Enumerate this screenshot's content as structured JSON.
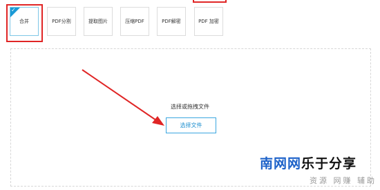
{
  "toolbar": {
    "tools": [
      {
        "label": "合并",
        "selected": true
      },
      {
        "label": "PDF分割"
      },
      {
        "label": "提取图片"
      },
      {
        "label": "压缩PDF"
      },
      {
        "label": "PDF解密"
      },
      {
        "label": "PDF 加密"
      }
    ]
  },
  "upload": {
    "hint": "选择或拖拽文件",
    "button_label": "选择文件"
  },
  "annotation": {
    "color": "#e02525"
  },
  "watermark": {
    "brand_part1": "南网网",
    "brand_part2": "乐于分享",
    "tagline": "资源 网赚 辅助"
  },
  "colors": {
    "accent": "#1a9ad6",
    "button_border": "#3aa6e0",
    "brand_blue": "#1d62c9"
  }
}
